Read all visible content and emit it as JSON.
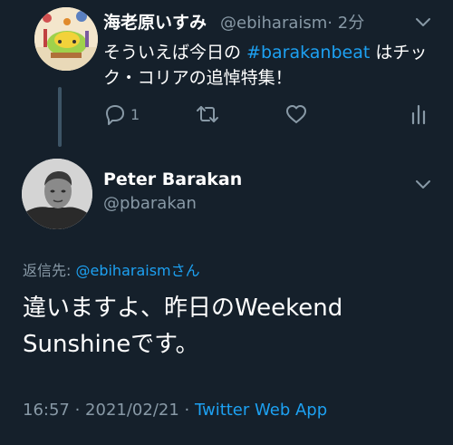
{
  "parent_tweet": {
    "display_name": "海老原いすみ",
    "handle": "@ebiharaism",
    "time": "· 2分",
    "text_before": "そういえば今日の ",
    "hashtag": "#barakanbeat",
    "text_after": " はチック・コリアの追悼特集！",
    "reply_count": "1",
    "icons": [
      "reply-icon",
      "retweet-icon",
      "like-icon",
      "analytics-icon",
      "chevron-down-icon"
    ]
  },
  "main_tweet": {
    "display_name": "Peter Barakan",
    "handle": "@pbarakan",
    "reply_prefix": "返信先: ",
    "reply_mention": "@ebiharaism",
    "reply_suffix": "さん",
    "text": "違いますよ、昨日のWeekend Sunshineです。",
    "time_date": "16:57 · 2021/02/21 · ",
    "client": "Twitter Web App"
  },
  "colors": {
    "background": "#15202b",
    "accent": "#1da1f2",
    "secondary_text": "#8899a6"
  }
}
